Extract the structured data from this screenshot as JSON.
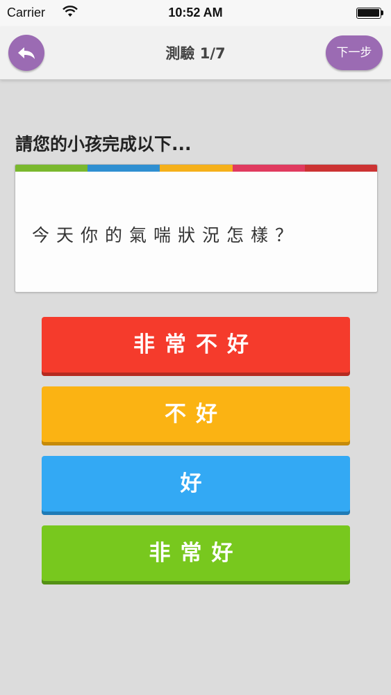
{
  "status_bar": {
    "carrier": "Carrier",
    "time": "10:52 AM"
  },
  "nav": {
    "title": "測驗 1/7",
    "next_label": "下一步",
    "back_icon": "back-arrow-icon"
  },
  "prompt": "請您的小孩完成以下...",
  "question": "今天你的氣喘狀況怎樣？",
  "answers": [
    {
      "label": "非常不好",
      "color": "#f53b2c"
    },
    {
      "label": "不好",
      "color": "#fbb313"
    },
    {
      "label": "好",
      "color": "#33a9f4"
    },
    {
      "label": "非常好",
      "color": "#78c81e"
    }
  ],
  "color_strip": [
    "#7ab82e",
    "#2f8fd1",
    "#f5b01a",
    "#e03a5f",
    "#cc3333"
  ],
  "accent_color": "#9b6bb3"
}
